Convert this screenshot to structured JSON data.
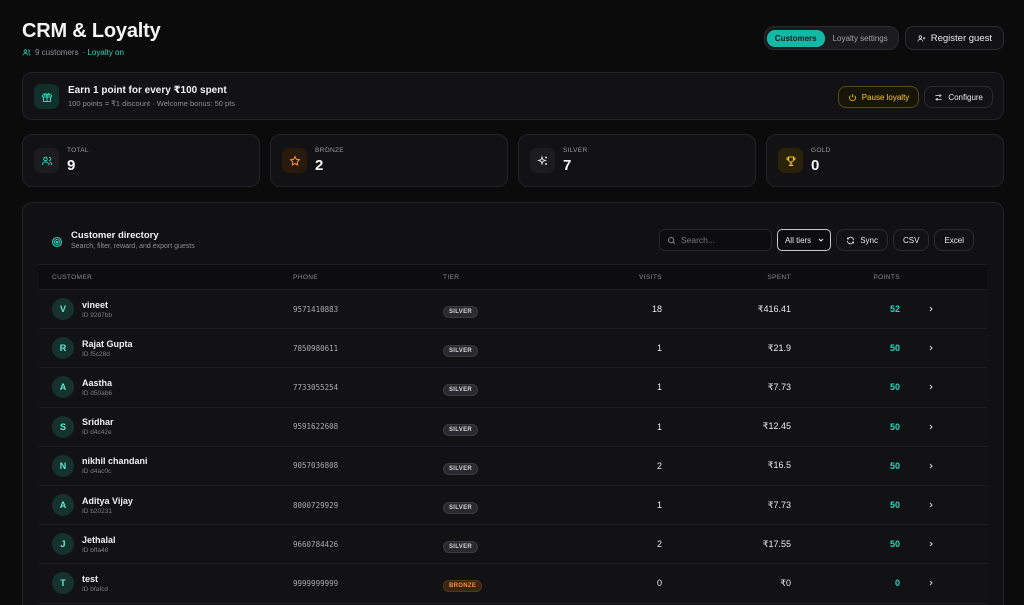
{
  "header": {
    "title": "CRM & Loyalty",
    "customer_count": "9 customers",
    "loyalty_status": "· Loyalty on"
  },
  "top": {
    "tabs": [
      {
        "label": "Customers",
        "active": true
      },
      {
        "label": "Loyalty settings",
        "active": false
      }
    ],
    "register_label": "Register guest"
  },
  "promo": {
    "title": "Earn 1 point for every ₹100 spent",
    "subtitle": "100 points = ₹1 discount · Welcome bonus: 50 pts",
    "pause_label": "Pause loyalty",
    "configure_label": "Configure"
  },
  "stats": [
    {
      "label": "TOTAL",
      "value": "9",
      "icon": "users-icon"
    },
    {
      "label": "BRONZE",
      "value": "2",
      "icon": "star-icon"
    },
    {
      "label": "SILVER",
      "value": "7",
      "icon": "sparkles-icon"
    },
    {
      "label": "GOLD",
      "value": "0",
      "icon": "trophy-icon"
    }
  ],
  "directory": {
    "title": "Customer directory",
    "subtitle": "Search, filter, reward, and export guests",
    "search_placeholder": "Search...",
    "tier_filter": "All tiers",
    "sync_label": "Sync",
    "csv_label": "CSV",
    "excel_label": "Excel",
    "columns": [
      "CUSTOMER",
      "PHONE",
      "TIER",
      "VISITS",
      "SPENT",
      "POINTS"
    ],
    "rows": [
      {
        "initial": "V",
        "name": "vineet",
        "id": "ID 9287bb",
        "phone": "9571410883",
        "tier": "SILVER",
        "visits": "18",
        "spent": "₹416.41",
        "points": "52"
      },
      {
        "initial": "R",
        "name": "Rajat Gupta",
        "id": "ID f5c28d",
        "phone": "7850980611",
        "tier": "SILVER",
        "visits": "1",
        "spent": "₹21.9",
        "points": "50"
      },
      {
        "initial": "A",
        "name": "Aastha",
        "id": "ID d50ab6",
        "phone": "7733055254",
        "tier": "SILVER",
        "visits": "1",
        "spent": "₹7.73",
        "points": "50"
      },
      {
        "initial": "S",
        "name": "Sridhar",
        "id": "ID d4c42e",
        "phone": "9591622608",
        "tier": "SILVER",
        "visits": "1",
        "spent": "₹12.45",
        "points": "50"
      },
      {
        "initial": "N",
        "name": "nikhil chandani",
        "id": "ID d4ac0c",
        "phone": "9057036808",
        "tier": "SILVER",
        "visits": "2",
        "spent": "₹16.5",
        "points": "50"
      },
      {
        "initial": "A",
        "name": "Aditya Vijay",
        "id": "ID b20231",
        "phone": "8000729929",
        "tier": "SILVER",
        "visits": "1",
        "spent": "₹7.73",
        "points": "50"
      },
      {
        "initial": "J",
        "name": "Jethalal",
        "id": "ID bffa48",
        "phone": "9660784426",
        "tier": "SILVER",
        "visits": "2",
        "spent": "₹17.55",
        "points": "50"
      },
      {
        "initial": "T",
        "name": "test",
        "id": "ID bfafcd",
        "phone": "9999999999",
        "tier": "BRONZE",
        "visits": "0",
        "spent": "₹0",
        "points": "0"
      }
    ]
  },
  "colors": {
    "accent": "#14b8a6",
    "warning": "#facc15",
    "bronze": "#fb923c",
    "background": "#0b0b0c"
  }
}
